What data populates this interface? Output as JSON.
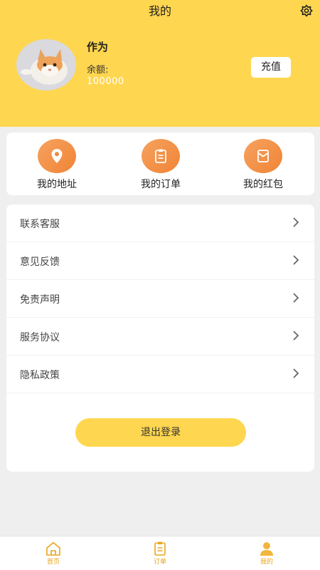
{
  "header": {
    "title": "我的",
    "settings_icon": "settings-flower-icon"
  },
  "profile": {
    "name": "作为",
    "balance_label": "余额:",
    "balance_value": "100000",
    "recharge_label": "充值",
    "avatar": "cat-avatar"
  },
  "quick_actions": [
    {
      "label": "我的地址",
      "icon": "location-pin-icon"
    },
    {
      "label": "我的订单",
      "icon": "order-list-icon"
    },
    {
      "label": "我的红包",
      "icon": "red-envelope-icon"
    }
  ],
  "menu": [
    {
      "label": "联系客服"
    },
    {
      "label": "意见反馈"
    },
    {
      "label": "免责声明"
    },
    {
      "label": "服务协议"
    },
    {
      "label": "隐私政策"
    }
  ],
  "logout_label": "退出登录",
  "tabbar": [
    {
      "label": "首页",
      "icon": "home-icon"
    },
    {
      "label": "订单",
      "icon": "order-icon"
    },
    {
      "label": "我的",
      "icon": "user-icon",
      "active": true
    }
  ],
  "colors": {
    "brand_yellow": "#ffd64f",
    "accent_orange": "#ef8436",
    "tab_label": "#e8a51c",
    "background": "#efefef"
  }
}
